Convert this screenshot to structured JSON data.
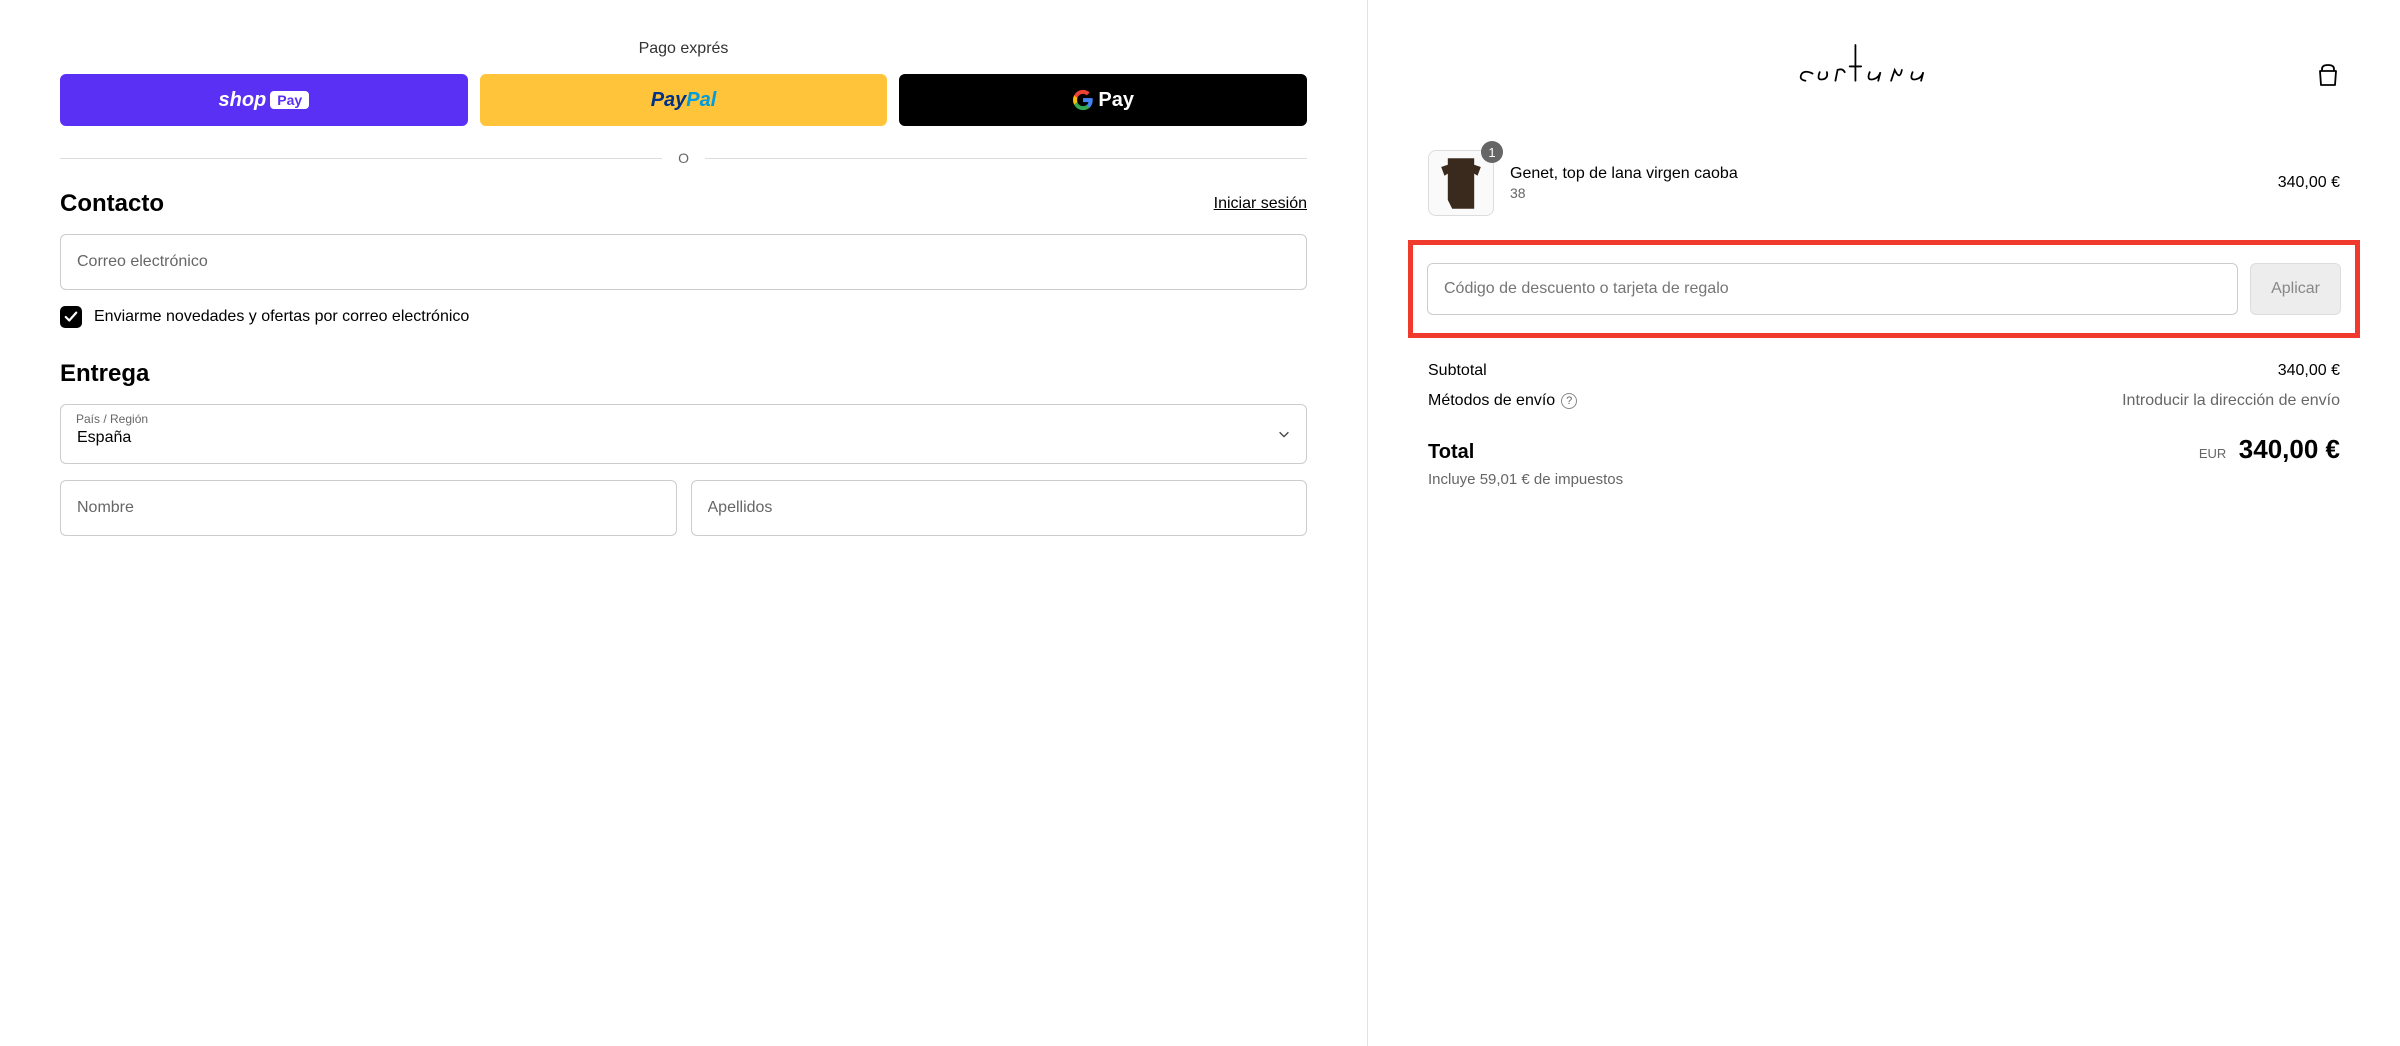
{
  "express": {
    "title": "Pago exprés",
    "shop_pay_word": "shop",
    "shop_pay_badge": "Pay",
    "paypal_pay": "Pay",
    "paypal_pal": "Pal",
    "gpay": "Pay",
    "divider": "O"
  },
  "contact": {
    "title": "Contacto",
    "login": "Iniciar sesión",
    "email_placeholder": "Correo electrónico",
    "newsletter_label": "Enviarme novedades y ofertas por correo electrónico",
    "newsletter_checked": true
  },
  "delivery": {
    "title": "Entrega",
    "country_label": "País / Región",
    "country_value": "España",
    "first_name_placeholder": "Nombre",
    "last_name_placeholder": "Apellidos"
  },
  "brand": {
    "name": "cortana"
  },
  "cart": {
    "item": {
      "name": "Genet, top de lana virgen caoba",
      "variant": "38",
      "qty": "1",
      "price": "340,00 €"
    }
  },
  "discount": {
    "placeholder": "Código de descuento o tarjeta de regalo",
    "apply": "Aplicar"
  },
  "summary": {
    "subtotal_label": "Subtotal",
    "subtotal_value": "340,00 €",
    "shipping_label": "Métodos de envío",
    "shipping_hint": "Introducir la dirección de envío",
    "total_label": "Total",
    "total_currency": "EUR",
    "total_value": "340,00 €",
    "tax_note": "Incluye 59,01 € de impuestos"
  }
}
